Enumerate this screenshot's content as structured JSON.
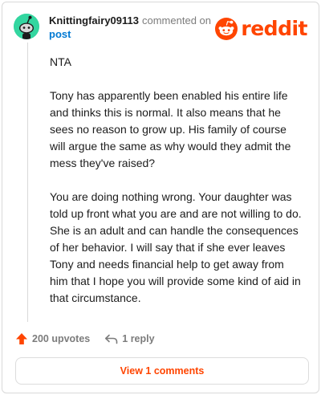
{
  "comment": {
    "username": "Knittingfairy09113",
    "action_text": "commented on",
    "post_link": "post",
    "paragraphs": [
      "NTA",
      "Tony has apparently been enabled his entire life and thinks this is normal. It also means that he sees no reason to grow up. His family of course will argue the same as why would they admit the mess they've raised?",
      "You are doing nothing wrong. Your daughter was told up front what you are and are not willing to do. She is an adult and can handle the consequences of her behavior. I will say that if she ever leaves Tony and needs financial help to get away from him that I hope you will provide some kind of aid in that circumstance."
    ],
    "upvotes_label": "200 upvotes",
    "reply_label": "1 reply",
    "view_comments_label": "View 1 comments"
  },
  "brand": {
    "wordmark": "reddit",
    "color": "#ff4500"
  },
  "icons": {
    "avatar": "snoo-avatar-icon",
    "logo": "reddit-snoo-icon",
    "upvote": "upvote-arrow-icon",
    "reply": "reply-arrow-icon"
  },
  "colors": {
    "accent": "#ff4500",
    "link": "#0079d3",
    "avatar_bg": "#33d6a0",
    "muted_text": "#7c7c7c"
  }
}
